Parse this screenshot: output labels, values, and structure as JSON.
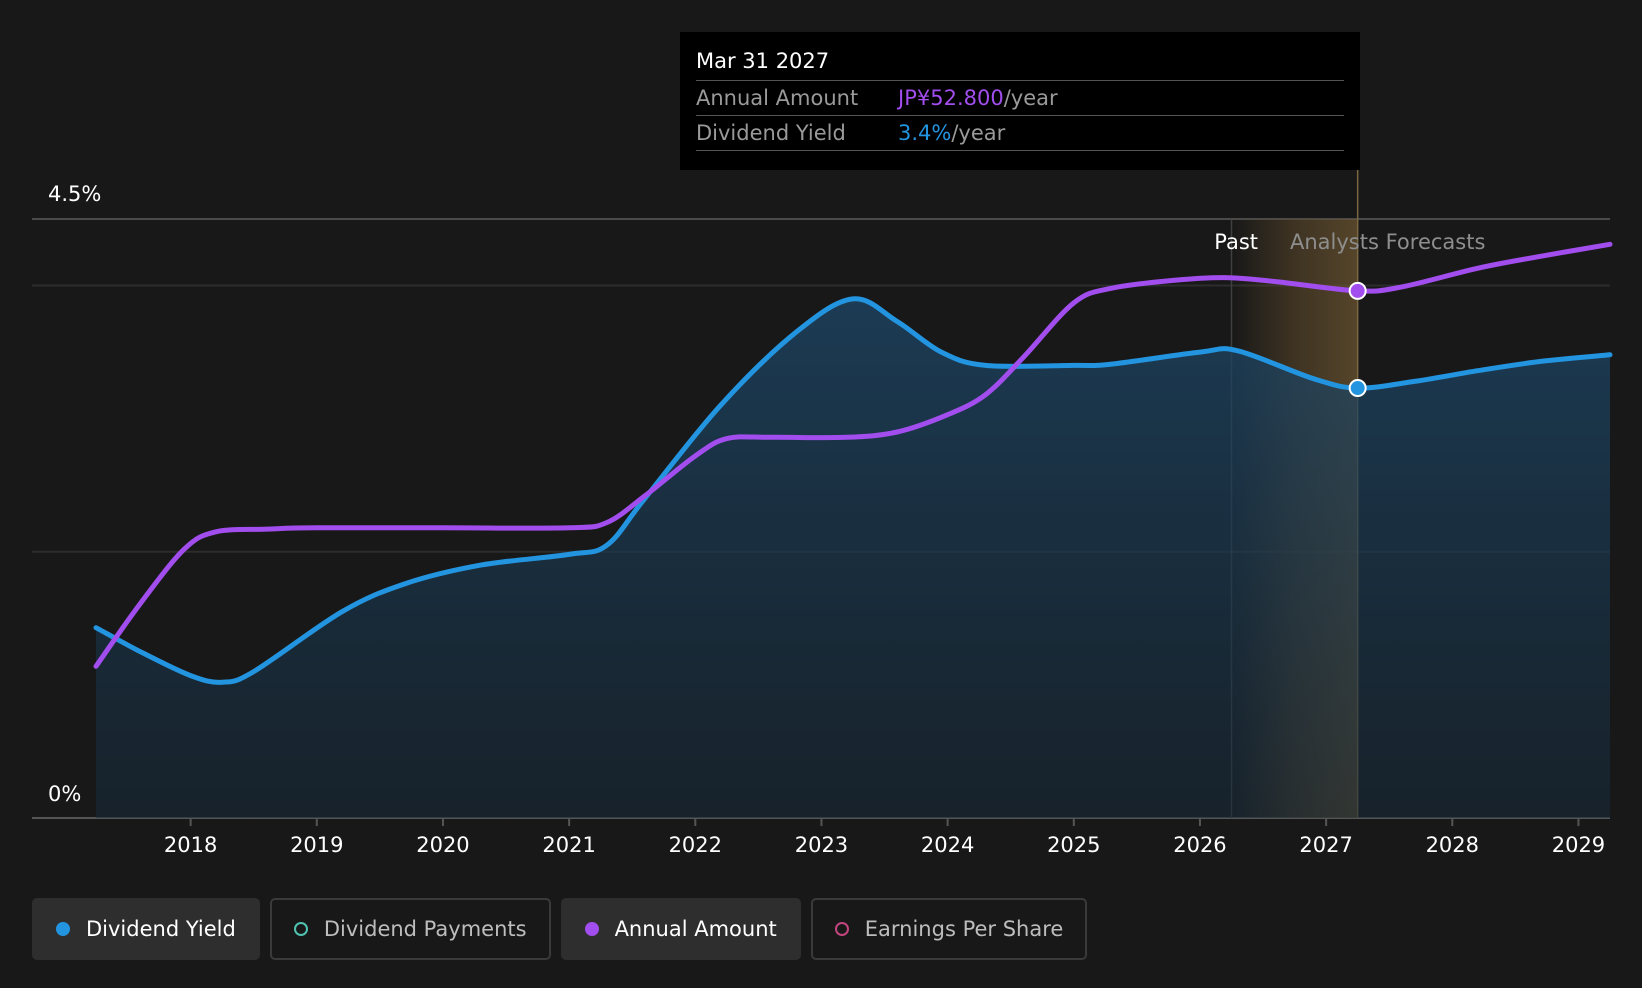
{
  "chart_data": {
    "type": "line",
    "y_axis": {
      "top_label": "4.5%",
      "bottom_label": "0%",
      "ylim": [
        0,
        4.5
      ]
    },
    "x_ticks": [
      "2018",
      "2019",
      "2020",
      "2021",
      "2022",
      "2023",
      "2024",
      "2025",
      "2026",
      "2027",
      "2028",
      "2029"
    ],
    "xlim": [
      2017.25,
      2029.25
    ],
    "region_labels": {
      "past": "Past",
      "forecast": "Analysts Forecasts"
    },
    "past_end": 2026.25,
    "selected_x": 2027.25,
    "series": [
      {
        "name": "Dividend Yield",
        "color": "#2394df",
        "fill": true,
        "points": [
          [
            2017.25,
            1.43
          ],
          [
            2017.6,
            1.25
          ],
          [
            2018.0,
            1.07
          ],
          [
            2018.25,
            1.02
          ],
          [
            2018.5,
            1.1
          ],
          [
            2019.2,
            1.55
          ],
          [
            2019.7,
            1.76
          ],
          [
            2020.3,
            1.9
          ],
          [
            2021.0,
            1.98
          ],
          [
            2021.3,
            2.05
          ],
          [
            2021.6,
            2.4
          ],
          [
            2022.2,
            3.1
          ],
          [
            2022.8,
            3.65
          ],
          [
            2023.25,
            3.9
          ],
          [
            2023.6,
            3.73
          ],
          [
            2023.95,
            3.5
          ],
          [
            2024.3,
            3.4
          ],
          [
            2025.0,
            3.4
          ],
          [
            2025.3,
            3.41
          ],
          [
            2026.0,
            3.5
          ],
          [
            2026.3,
            3.51
          ],
          [
            2026.9,
            3.3
          ],
          [
            2027.25,
            3.23
          ],
          [
            2027.7,
            3.28
          ],
          [
            2028.2,
            3.36
          ],
          [
            2028.7,
            3.43
          ],
          [
            2029.25,
            3.48
          ]
        ]
      },
      {
        "name": "Annual Amount",
        "color": "#a24ded",
        "fill": false,
        "points": [
          [
            2017.25,
            1.14
          ],
          [
            2017.6,
            1.61
          ],
          [
            2017.95,
            2.02
          ],
          [
            2018.2,
            2.15
          ],
          [
            2018.6,
            2.17
          ],
          [
            2019.0,
            2.18
          ],
          [
            2020.0,
            2.18
          ],
          [
            2021.0,
            2.18
          ],
          [
            2021.3,
            2.22
          ],
          [
            2021.6,
            2.42
          ],
          [
            2022.0,
            2.72
          ],
          [
            2022.25,
            2.85
          ],
          [
            2022.6,
            2.86
          ],
          [
            2023.2,
            2.86
          ],
          [
            2023.6,
            2.9
          ],
          [
            2024.0,
            3.03
          ],
          [
            2024.3,
            3.18
          ],
          [
            2024.6,
            3.46
          ],
          [
            2025.0,
            3.87
          ],
          [
            2025.3,
            3.98
          ],
          [
            2025.8,
            4.04
          ],
          [
            2026.2,
            4.06
          ],
          [
            2026.6,
            4.03
          ],
          [
            2027.25,
            3.96
          ],
          [
            2027.6,
            3.99
          ],
          [
            2028.2,
            4.13
          ],
          [
            2028.7,
            4.22
          ],
          [
            2029.25,
            4.31
          ]
        ]
      }
    ]
  },
  "tooltip": {
    "date": "Mar 31 2027",
    "rows": [
      {
        "label": "Annual Amount",
        "value": "JP¥52.800",
        "unit": "/year",
        "color": "#a24ded"
      },
      {
        "label": "Dividend Yield",
        "value": "3.4%",
        "unit": "/year",
        "color": "#2394df"
      }
    ]
  },
  "legend": [
    {
      "label": "Dividend Yield",
      "color": "#2394df",
      "filled": true,
      "active": true
    },
    {
      "label": "Dividend Payments",
      "color": "#4fc3b0",
      "filled": false,
      "active": false
    },
    {
      "label": "Annual Amount",
      "color": "#a24ded",
      "filled": true,
      "active": true
    },
    {
      "label": "Earnings Per Share",
      "color": "#c2457f",
      "filled": false,
      "active": false
    }
  ]
}
